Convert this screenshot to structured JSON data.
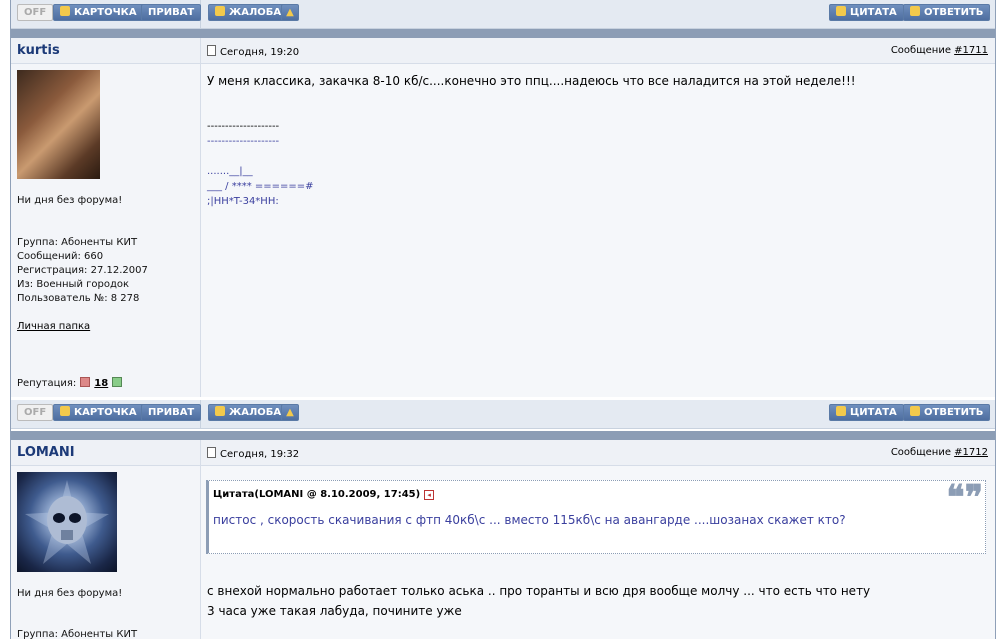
{
  "buttons": {
    "off": "OFF",
    "card": "КАРТОЧКА",
    "private": "ПРИВАТ",
    "complaint": "ЖАЛОБА",
    "quote": "ЦИТАТА",
    "reply": "ОТВЕТИТЬ"
  },
  "posts": [
    {
      "username": "kurtis",
      "time": "Сегодня, 19:20",
      "message_label": "Сообщение",
      "message_num": "#1711",
      "tagline": "Ни дня без форума!",
      "group": "Группа: Абоненты КИТ",
      "messages": "Сообщений: 660",
      "registered": "Регистрация: 27.12.2007",
      "from": "Из: Военный городок",
      "user_no": "Пользователь №: 8 278",
      "folder": "Личная папка",
      "reputation_label": "Репутация:",
      "reputation_value": "18",
      "body": "У меня классика, закачка 8-10 кб/с....конечно это ппц....надеюсь что все наладится на этой неделе!!!",
      "sig": [
        "--------------------",
        "--------------------",
        ".......__|__",
        "___ / **** ======#",
        ";|HH*T-34*HH:"
      ]
    },
    {
      "username": "LOMANI",
      "time": "Сегодня, 19:32",
      "message_label": "Сообщение",
      "message_num": "#1712",
      "tagline": "Ни дня без форума!",
      "group": "Группа: Абоненты КИТ",
      "quote_head": "Цитата(LOMANI @ 8.10.2009, 17:45)",
      "quote_text": "пистос , скорость скачивания с фтп 40кб\\с ... вместо 115кб\\с на авангарде ....шозанах скажет кто?",
      "body_lines": [
        "с внехой нормально работает только аська .. про торанты и всю дря вообще молчу ... что есть что нету",
        "3 часа уже такая лабуда, почините уже"
      ]
    }
  ]
}
